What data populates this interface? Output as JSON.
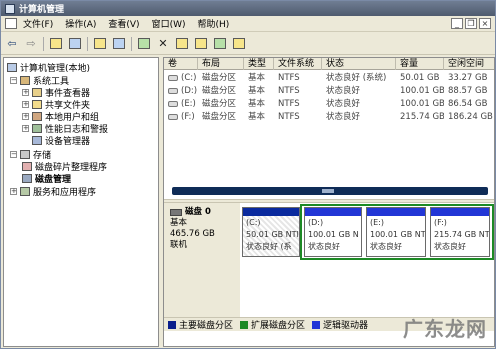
{
  "window": {
    "title": "计算机管理"
  },
  "menu": [
    "文件(F)",
    "操作(A)",
    "查看(V)",
    "窗口(W)",
    "帮助(H)"
  ],
  "window_controls": [
    "_",
    "❐",
    "×"
  ],
  "toolbar": {
    "icons": [
      "back-icon",
      "forward-icon",
      "up-folder-icon",
      "show-tree-icon",
      "properties-icon",
      "help-icon",
      "refresh-icon",
      "delete-icon",
      "open-icon",
      "explore-icon",
      "search-icon",
      "format-icon"
    ]
  },
  "tree": {
    "root": "计算机管理(本地)",
    "system_tools": "系统工具",
    "event_viewer": "事件查看器",
    "shared_folders": "共享文件夹",
    "local_users": "本地用户和组",
    "perf_logs": "性能日志和警报",
    "device_manager": "设备管理器",
    "storage": "存储",
    "defrag": "磁盘碎片整理程序",
    "disk_mgmt": "磁盘管理",
    "services": "服务和应用程序"
  },
  "volume_table": {
    "headers": [
      "卷",
      "布局",
      "类型",
      "文件系统",
      "状态",
      "容量",
      "空闲空间"
    ],
    "rows": [
      [
        "(C:)",
        "磁盘分区",
        "基本",
        "NTFS",
        "状态良好 (系统)",
        "50.01 GB",
        "33.27 GB"
      ],
      [
        "(D:)",
        "磁盘分区",
        "基本",
        "NTFS",
        "状态良好",
        "100.01 GB",
        "88.57 GB"
      ],
      [
        "(E:)",
        "磁盘分区",
        "基本",
        "NTFS",
        "状态良好",
        "100.01 GB",
        "86.54 GB"
      ],
      [
        "(F:)",
        "磁盘分区",
        "基本",
        "NTFS",
        "状态良好",
        "215.74 GB",
        "186.24 GB"
      ]
    ]
  },
  "disk": {
    "name": "磁盘 0",
    "type": "基本",
    "size": "465.76 GB",
    "state": "联机",
    "partitions": [
      {
        "label": "(C:)",
        "size": "50.01 GB NTI",
        "status": "状态良好 (系"
      },
      {
        "label": "(D:)",
        "size": "100.01 GB N",
        "status": "状态良好"
      },
      {
        "label": "(E:)",
        "size": "100.01 GB NTI",
        "status": "状态良好"
      },
      {
        "label": "(F:)",
        "size": "215.74 GB NTI",
        "status": "状态良好"
      }
    ]
  },
  "legend": [
    {
      "label": "主要磁盘分区",
      "color": "#0a1e8c"
    },
    {
      "label": "扩展磁盘分区",
      "color": "#1d8a25"
    },
    {
      "label": "逻辑驱动器",
      "color": "#2236d6"
    }
  ],
  "watermark": "广东龙网"
}
